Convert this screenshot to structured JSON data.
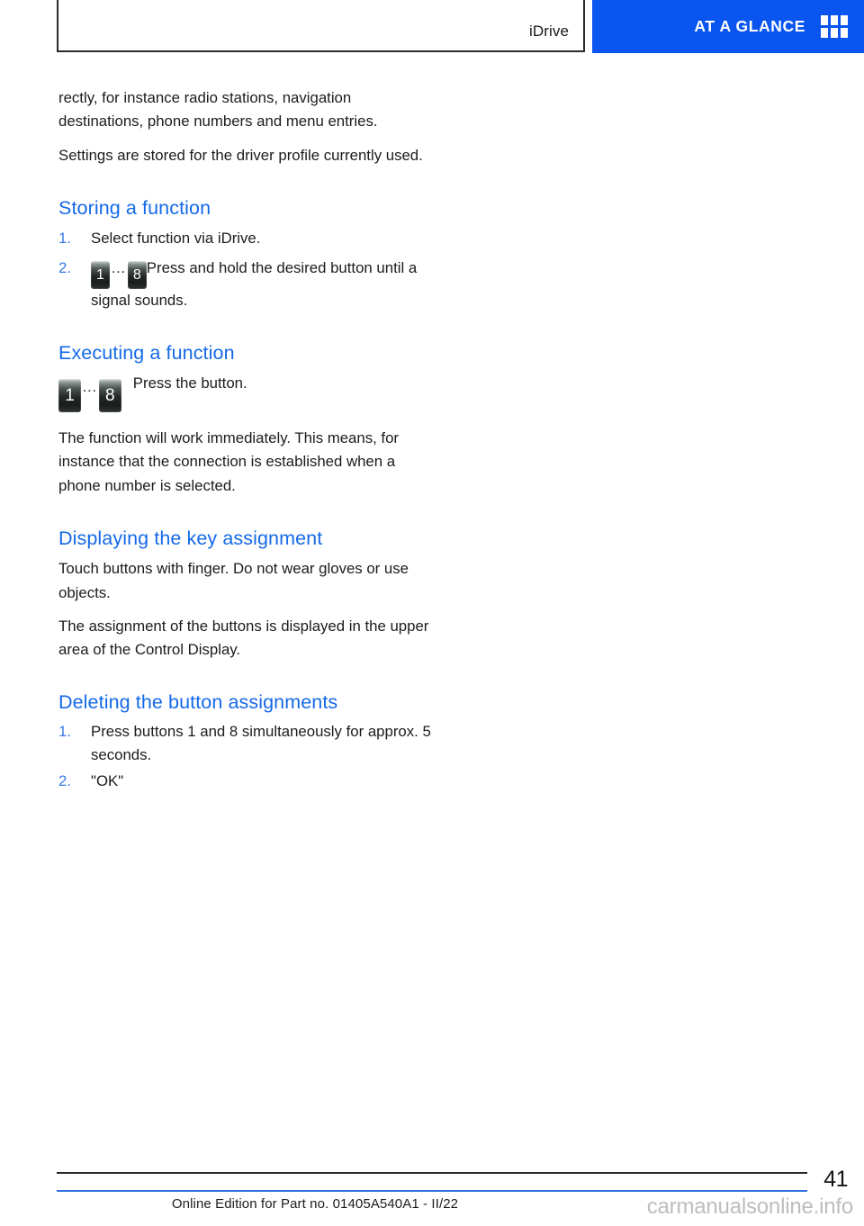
{
  "header": {
    "chapter_label": "iDrive",
    "glance_label": "AT A GLANCE",
    "glance_icon": "grid-icon"
  },
  "content": {
    "intro_paragraphs": [
      "rectly, for instance radio stations, navigation destinations, phone numbers and menu entries.",
      "Settings are stored for the driver profile currently used."
    ],
    "sections": [
      {
        "heading": "Storing a function",
        "steps": [
          {
            "num": "1.",
            "text": "Select function via iDrive."
          },
          {
            "num": "2.",
            "key_from": "1",
            "key_to": "8",
            "ellipsis": "…",
            "text": "Press and hold the desired button until a signal sounds."
          }
        ]
      },
      {
        "heading": "Executing a function",
        "key_from": "1",
        "key_to": "8",
        "ellipsis": "…",
        "key_text": "Press the button.",
        "paragraphs": [
          "The function will work immediately. This means, for instance that the connection is established when a phone number is selected."
        ]
      },
      {
        "heading": "Displaying the key assignment",
        "paragraphs": [
          "Touch buttons with finger. Do not wear gloves or use objects.",
          "The assignment of the buttons is displayed in the upper area of the Control Display."
        ]
      },
      {
        "heading": "Deleting the button assignments",
        "steps": [
          {
            "num": "1.",
            "text": "Press buttons 1 and 8 simultaneously for approx. 5 seconds."
          },
          {
            "num": "2.",
            "text": "\"OK\""
          }
        ]
      }
    ]
  },
  "footer": {
    "page_number": "41",
    "edition_text": "Online Edition for Part no. 01405A540A1 - II/22",
    "watermark": "carmanualsonline.info"
  },
  "colors": {
    "brand_blue": "#0a55ef",
    "heading_blue": "#1569e8",
    "list_marker_blue": "#3a7ce8",
    "rule_blue": "#2f6fe0",
    "body_text": "#1c1c1e"
  }
}
